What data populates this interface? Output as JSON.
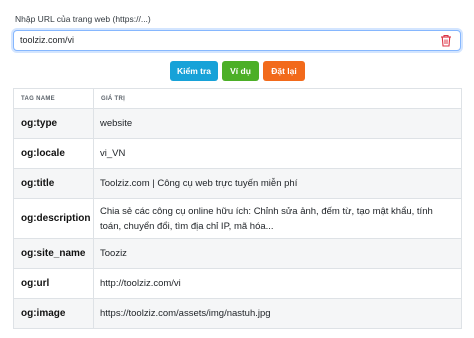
{
  "form": {
    "url_label": "Nhập URL của trang web (https://...)",
    "url_value": "toolziz.com/vi",
    "clear_icon": "trash-icon",
    "clear_icon_color": "#dc3545"
  },
  "buttons": {
    "check_label": "Kiểm tra",
    "example_label": "Ví dụ",
    "reset_label": "Đặt lại",
    "check_color": "#17a2d8",
    "example_color": "#4caf27",
    "reset_color": "#f26a1b"
  },
  "table": {
    "headers": [
      "TAG NAME",
      "GIÁ TRỊ"
    ],
    "rows": [
      {
        "tag": "og:type",
        "value": "website"
      },
      {
        "tag": "og:locale",
        "value": "vi_VN"
      },
      {
        "tag": "og:title",
        "value": "Toolziz.com | Công cụ web trực tuyến miễn phí"
      },
      {
        "tag": "og:description",
        "value": "Chia sẻ các công cụ online hữu ích: Chỉnh sửa ảnh, đếm từ, tạo mật khẩu, tính toán, chuyển đổi, tìm địa chỉ IP, mã hóa..."
      },
      {
        "tag": "og:site_name",
        "value": "Tooziz"
      },
      {
        "tag": "og:url",
        "value": "http://toolziz.com/vi"
      },
      {
        "tag": "og:image",
        "value": "https://toolziz.com/assets/img/nastuh.jpg"
      }
    ]
  }
}
